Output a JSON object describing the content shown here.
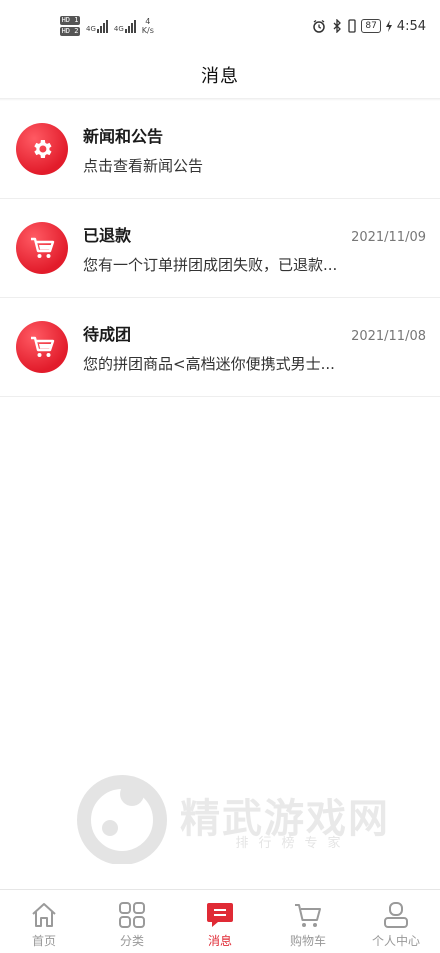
{
  "status_bar": {
    "sim1": "HD 1",
    "sim2": "HD 2",
    "net1": "4G",
    "net2": "4G",
    "speed_value": "4",
    "speed_unit": "K/s",
    "battery": "87",
    "time": "4:54"
  },
  "header": {
    "title": "消息"
  },
  "messages": [
    {
      "icon": "gear-icon",
      "title": "新闻和公告",
      "date": "",
      "text": "点击查看新闻公告"
    },
    {
      "icon": "cart-icon",
      "title": "已退款",
      "date": "2021/11/09",
      "text": "您有一个订单拼团成团失败，已退款..."
    },
    {
      "icon": "cart-icon",
      "title": "待成团",
      "date": "2021/11/08",
      "text": "您的拼团商品<高档迷你便携式男士..."
    }
  ],
  "watermark": {
    "name": "精武游戏网",
    "sub": "排行榜专家"
  },
  "tabbar": {
    "items": [
      {
        "label": "首页",
        "icon": "home-icon",
        "active": false
      },
      {
        "label": "分类",
        "icon": "grid-icon",
        "active": false
      },
      {
        "label": "消息",
        "icon": "message-icon",
        "active": true
      },
      {
        "label": "购物车",
        "icon": "cart-icon",
        "active": false
      },
      {
        "label": "个人中心",
        "icon": "user-icon",
        "active": false
      }
    ]
  },
  "colors": {
    "accent": "#e02a35",
    "inactive": "#999999"
  }
}
